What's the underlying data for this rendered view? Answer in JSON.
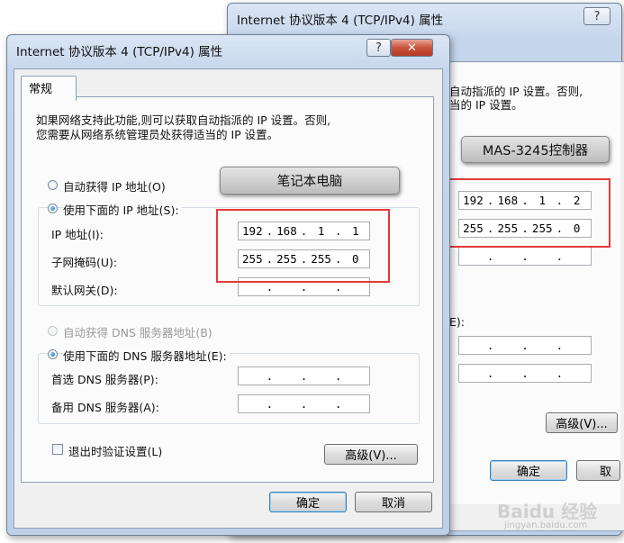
{
  "back_dialog": {
    "title": "Internet 协议版本 4 (TCP/IPv4) 属性",
    "help_label": "?",
    "close_label": "✕",
    "intro_line1": "自动指派的 IP 设置。否则,",
    "intro_line2": "当的 IP 设置。",
    "ip": [
      "192",
      "168",
      "1",
      "2"
    ],
    "mask": [
      "255",
      "255",
      "255",
      "0"
    ],
    "dns_label_fragment": "E):",
    "advanced_label": "高级(V)...",
    "ok_label": "确定",
    "cancel_fragment": "取"
  },
  "back_callout": "MAS-3245控制器",
  "front_dialog": {
    "title": "Internet 协议版本 4 (TCP/IPv4) 属性",
    "help_label": "?",
    "close_label": "✕",
    "tab": "常规",
    "intro_line1": "如果网络支持此功能,则可以获取自动指派的 IP 设置。否则,",
    "intro_line2": "您需要从网络系统管理员处获得适当的 IP 设置。",
    "auto_ip_label": "自动获得 IP 地址(O)",
    "manual_ip_label": "使用下面的 IP 地址(S):",
    "ip_label": "IP 地址(I):",
    "ip": [
      "192",
      "168",
      "1",
      "1"
    ],
    "mask_label": "子网掩码(U):",
    "mask": [
      "255",
      "255",
      "255",
      "0"
    ],
    "gateway_label": "默认网关(D):",
    "auto_dns_label": "自动获得 DNS 服务器地址(B)",
    "manual_dns_label": "使用下面的 DNS 服务器地址(E):",
    "preferred_dns_label": "首选 DNS 服务器(P):",
    "alternate_dns_label": "备用 DNS 服务器(A):",
    "validate_label": "退出时验证设置(L)",
    "advanced_label": "高级(V)...",
    "ok_label": "确定",
    "cancel_label": "取消",
    "selected_ip_mode": "manual",
    "selected_dns_mode": "manual",
    "validate_checked": false
  },
  "front_callout": "笔记本电脑",
  "watermark": {
    "brand": "Baidu 经验",
    "url": "jingyan.baidu.com"
  },
  "colors": {
    "highlight_box": "#e23a3a",
    "title_bar": "#c5d6ec"
  }
}
